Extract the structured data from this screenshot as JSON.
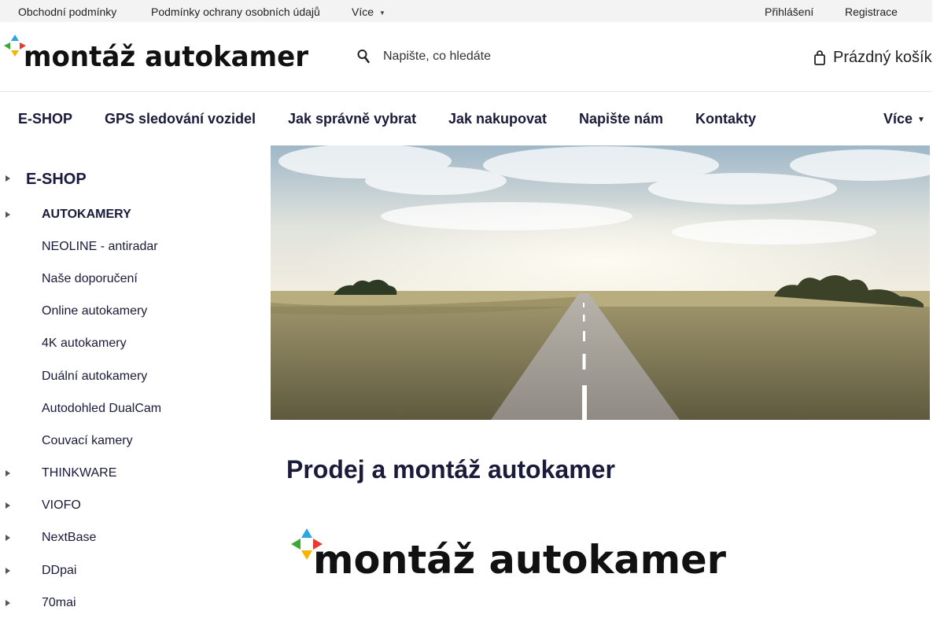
{
  "topbar": {
    "links": [
      "Obchodní podmínky",
      "Podmínky ochrany osobních údajů",
      "Více"
    ],
    "login": "Přihlášení",
    "register": "Registrace"
  },
  "header": {
    "logo_text": "montáž autokamer",
    "search_placeholder": "Napište, co hledáte",
    "cart_label": "Prázdný košík"
  },
  "main_nav": {
    "items": [
      "E-SHOP",
      "GPS sledování vozidel",
      "Jak správně vybrat",
      "Jak nakupovat",
      "Napište nám",
      "Kontakty"
    ],
    "more": "Více"
  },
  "sidebar": {
    "title": "E-SHOP",
    "items": [
      {
        "label": "AUTOKAMERY",
        "expandable": true,
        "bold": true
      },
      {
        "label": "NEOLINE - antiradar",
        "expandable": false
      },
      {
        "label": "Naše doporučení",
        "expandable": false
      },
      {
        "label": "Online autokamery",
        "expandable": false
      },
      {
        "label": "4K autokamery",
        "expandable": false
      },
      {
        "label": "Duální autokamery",
        "expandable": false
      },
      {
        "label": "Autodohled DualCam",
        "expandable": false
      },
      {
        "label": "Couvací kamery",
        "expandable": false
      },
      {
        "label": "THINKWARE",
        "expandable": true
      },
      {
        "label": "VIOFO",
        "expandable": true
      },
      {
        "label": "NextBase",
        "expandable": true
      },
      {
        "label": "DDpai",
        "expandable": true
      },
      {
        "label": "70mai",
        "expandable": true
      }
    ]
  },
  "content": {
    "title": "Prodej a montáž autokamer",
    "logo_text": "montáž autokamer"
  },
  "colors": {
    "heading": "#1a1a3a",
    "topbar_bg": "#f3f3f3",
    "logo_blue": "#2aa7e0",
    "logo_red": "#e63a2e",
    "logo_yellow": "#f4b400",
    "logo_green": "#3aaa35"
  },
  "icons": [
    "search-icon",
    "cart-icon",
    "chevron-down-icon",
    "chevron-right-icon",
    "logo-compass-icon"
  ]
}
